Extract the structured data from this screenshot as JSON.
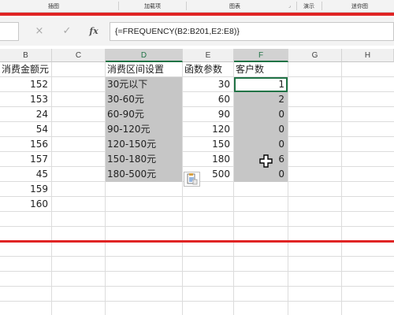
{
  "ribbon": {
    "groups": [
      "插图",
      "加载项",
      "图表",
      "演示",
      "迷你图"
    ]
  },
  "formula_bar": {
    "cancel_icon": "×",
    "enter_icon": "✓",
    "fx_label": "fx",
    "formula": "{=FREQUENCY(B2:B201,E2:E8)}"
  },
  "columns": [
    "B",
    "C",
    "D",
    "E",
    "F",
    "G",
    "H"
  ],
  "rows": [
    {
      "B": "消费金额元",
      "C": "",
      "D": "消费区间设置",
      "E": "函数参数",
      "F": "客户数"
    },
    {
      "B": "152",
      "C": "",
      "D": "30元以下",
      "E": "30",
      "F": "1"
    },
    {
      "B": "153",
      "C": "",
      "D": "30-60元",
      "E": "60",
      "F": "2"
    },
    {
      "B": "24",
      "C": "",
      "D": "60-90元",
      "E": "90",
      "F": "0"
    },
    {
      "B": "54",
      "C": "",
      "D": "90-120元",
      "E": "120",
      "F": "0"
    },
    {
      "B": "156",
      "C": "",
      "D": "120-150元",
      "E": "150",
      "F": "0"
    },
    {
      "B": "157",
      "C": "",
      "D": "150-180元",
      "E": "180",
      "F": "6"
    },
    {
      "B": "45",
      "C": "",
      "D": "180-500元",
      "E": "500",
      "F": "0"
    },
    {
      "B": "159",
      "C": "",
      "D": "",
      "E": "",
      "F": ""
    },
    {
      "B": "160",
      "C": "",
      "D": "",
      "E": "",
      "F": ""
    }
  ],
  "colors": {
    "selection_gray": "#c6c6c6",
    "annotation_red": "#e02424",
    "excel_green": "#217346"
  }
}
